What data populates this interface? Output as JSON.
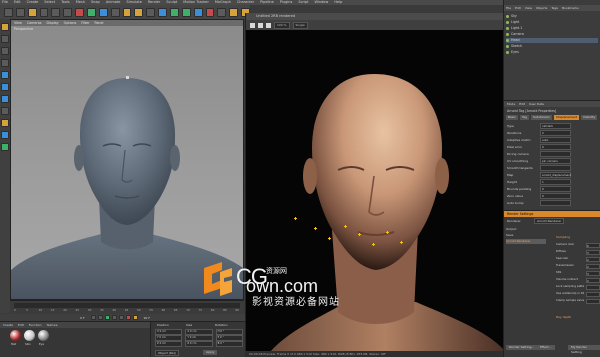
{
  "menubar": {
    "items": [
      "File",
      "Edit",
      "Create",
      "Select",
      "Tools",
      "Mesh",
      "Snap",
      "Animate",
      "Simulate",
      "Render",
      "Sculpt",
      "Motion Tracker",
      "MoGraph",
      "Character",
      "Pipeline",
      "Plugins",
      "Script",
      "Window",
      "Help"
    ]
  },
  "viewport_left": {
    "menu": [
      "View",
      "Cameras",
      "Display",
      "Options",
      "Filter",
      "Panel"
    ],
    "label": "Perspective"
  },
  "render_view": {
    "title": "Untitled 2RB rendered",
    "zoom": "100 %",
    "mode_select": "Single",
    "status": "00:00:08  Preview: Frame 0 of 0  480 x 510  Size: 480 x 510, RGB (8 Bit), 955 KB, Stereo: Off"
  },
  "watermark": {
    "cg": "CG",
    "cn_small": "资源网",
    "own": "own.com",
    "subtitle": "影视资源必备网站"
  },
  "object_manager": {
    "menu": [
      "File",
      "Edit",
      "View",
      "Objects",
      "Tags",
      "Bookmarks"
    ],
    "rows": [
      {
        "name": "Sky"
      },
      {
        "name": "Light"
      },
      {
        "name": "Light.1"
      },
      {
        "name": "Camera"
      },
      {
        "name": "Head"
      },
      {
        "name": "Sketch"
      },
      {
        "name": "Eyes"
      }
    ]
  },
  "attribute_manager": {
    "menu": [
      "Mode",
      "Edit",
      "User Data"
    ],
    "header": "Arnold Tag [Arnold Properties]",
    "tabs": [
      "Basic",
      "Tag",
      "Subdivision",
      "Displacement",
      "Visibility"
    ],
    "rows": [
      {
        "label": "Type",
        "value": "catclark"
      },
      {
        "label": "Iterations",
        "value": "2"
      },
      {
        "label": "Adaptive metric",
        "value": "auto"
      },
      {
        "label": "Pixel error",
        "value": "0"
      },
      {
        "label": "Dicing camera",
        "value": ""
      },
      {
        "label": "UV smoothing",
        "value": "pin corners"
      },
      {
        "label": "Smooth tangents",
        "value": ""
      },
      {
        "label": "Map",
        "value": "arnold_displacement"
      },
      {
        "label": "Height",
        "value": "1"
      },
      {
        "label": "Bounds padding",
        "value": "0"
      },
      {
        "label": "Zero value",
        "value": "0"
      },
      {
        "label": "Auto bump",
        "value": ""
      }
    ]
  },
  "render_settings": {
    "title": "Render Settings",
    "renderer_label": "Renderer",
    "renderer_value": "Arnold Renderer",
    "sidebar": [
      "Output",
      "Save",
      "Arnold Renderer"
    ],
    "section": "Sampling",
    "rows": [
      {
        "label": "Camera (AA)",
        "value": "6"
      },
      {
        "label": "Diffuse",
        "value": "3"
      },
      {
        "label": "Specular",
        "value": "2"
      },
      {
        "label": "Transmission",
        "value": "2"
      },
      {
        "label": "SSS",
        "value": "3"
      },
      {
        "label": "Volume indirect",
        "value": "2"
      },
      {
        "label": "Lock sampling pattern",
        "value": ""
      },
      {
        "label": "Use autobump in SSS",
        "value": ""
      },
      {
        "label": "Clamp sample values",
        "value": ""
      }
    ],
    "buttons": [
      "Render Setting...",
      "Effect...",
      "My Render Setting"
    ],
    "ray_depth": "Ray depth"
  },
  "timeline": {
    "ticks": [
      "0",
      "5",
      "10",
      "15",
      "20",
      "25",
      "30",
      "35",
      "40",
      "45",
      "50",
      "55",
      "60",
      "65",
      "70",
      "75",
      "80",
      "85",
      "90"
    ],
    "current_frame": "0 F",
    "end_frame": "90 F"
  },
  "material_manager": {
    "menu": [
      "Create",
      "Edit",
      "Function",
      "Texture"
    ],
    "materials": [
      {
        "name": "Mat",
        "color": "#b02a2a"
      },
      {
        "name": "Skin",
        "color": "#c9c9c9"
      },
      {
        "name": "Eye",
        "color": "#8a8a8a"
      }
    ]
  },
  "coordinates": {
    "headers": [
      "Position",
      "Size",
      "Rotation"
    ],
    "rows": [
      [
        "X  0 cm",
        "X  0 cm",
        "H  0 °"
      ],
      [
        "Y  0 cm",
        "Y  0 cm",
        "P  0 °"
      ],
      [
        "Z  0 cm",
        "Z  0 cm",
        "B  0 °"
      ]
    ],
    "mode": "Object (Rel)",
    "apply": "Apply"
  }
}
